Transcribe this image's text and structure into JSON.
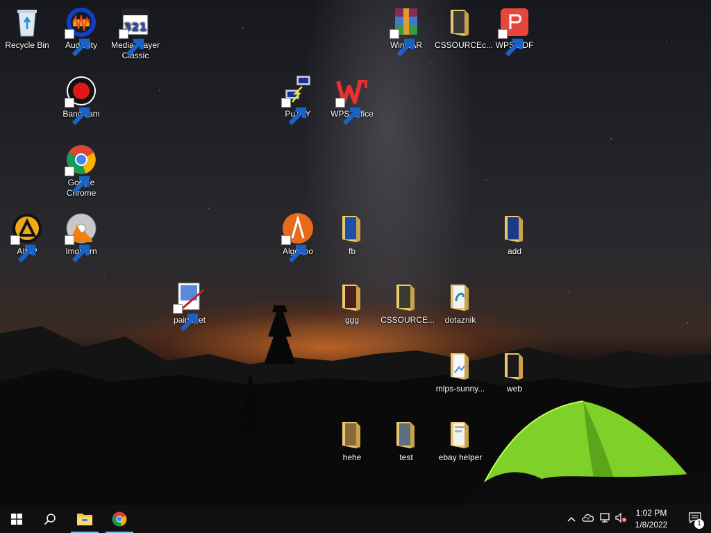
{
  "desktop": {
    "icons": [
      {
        "label": "Recycle Bin",
        "icon": "recycle-bin-icon"
      },
      {
        "label": "Audacity",
        "icon": "audacity-icon"
      },
      {
        "label": "Media Player Classic",
        "icon": "media-player-classic-icon"
      },
      {
        "label": "WinRAR",
        "icon": "winrar-icon"
      },
      {
        "label": "CSSOURCEc...",
        "icon": "folder-icon"
      },
      {
        "label": "WPS PDF",
        "icon": "wps-pdf-icon"
      },
      {
        "label": "Bandicam",
        "icon": "bandicam-icon"
      },
      {
        "label": "PuTTY",
        "icon": "putty-icon"
      },
      {
        "label": "WPS Office",
        "icon": "wps-office-icon"
      },
      {
        "label": "Google Chrome",
        "icon": "chrome-icon"
      },
      {
        "label": "AIMP",
        "icon": "aimp-icon"
      },
      {
        "label": "ImgBurn",
        "icon": "imgburn-icon"
      },
      {
        "label": "Algodoo",
        "icon": "algodoo-icon"
      },
      {
        "label": "fb",
        "icon": "folder-icon"
      },
      {
        "label": "add",
        "icon": "folder-icon"
      },
      {
        "label": "paint.net",
        "icon": "paint-net-icon"
      },
      {
        "label": "ggg",
        "icon": "folder-icon"
      },
      {
        "label": "CSSOURCE...",
        "icon": "folder-icon"
      },
      {
        "label": "dotaznik",
        "icon": "folder-icon"
      },
      {
        "label": "mlps-sunny...",
        "icon": "folder-icon"
      },
      {
        "label": "web",
        "icon": "folder-icon"
      },
      {
        "label": "hehe",
        "icon": "folder-icon"
      },
      {
        "label": "test",
        "icon": "folder-icon"
      },
      {
        "label": "ebay helper",
        "icon": "folder-icon"
      }
    ]
  },
  "taskbar": {
    "start": "windows-start-icon",
    "search": "search-icon",
    "pinned": [
      {
        "icon": "file-explorer-icon"
      },
      {
        "icon": "chrome-icon"
      }
    ],
    "tray": [
      "chevron-up-icon",
      "onedrive-icon",
      "network-icon",
      "volume-muted-icon"
    ],
    "clock": {
      "time": "1:02 PM",
      "date": "1/8/2022"
    },
    "notifications": {
      "icon": "notification-icon",
      "count": "1"
    }
  }
}
